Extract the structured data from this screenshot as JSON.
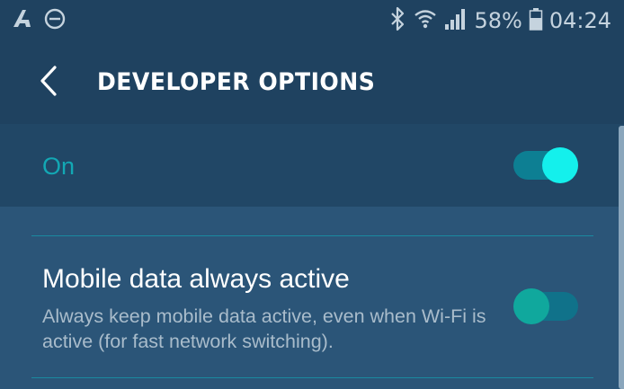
{
  "status_bar": {
    "left_icons": [
      "app-notification-icon",
      "do-not-disturb-icon"
    ],
    "right_icons": [
      "bluetooth-icon",
      "wifi-icon",
      "cellular-signal-icon",
      "battery-icon"
    ],
    "battery_percent": "58%",
    "time": "04:24"
  },
  "header": {
    "back_icon": "chevron-left-icon",
    "title": "DEVELOPER OPTIONS"
  },
  "master_switch": {
    "label": "On",
    "checked": true
  },
  "settings": [
    {
      "title": "Mobile data always active",
      "summary": "Always keep mobile data active, even when Wi-Fi is active (for fast network switching).",
      "checked": true
    }
  ],
  "colors": {
    "background": "#2b5578",
    "header": "#1f4260",
    "accent": "#14f0ec",
    "accent_label": "#13a8b4",
    "divider": "#1a8aa0"
  }
}
